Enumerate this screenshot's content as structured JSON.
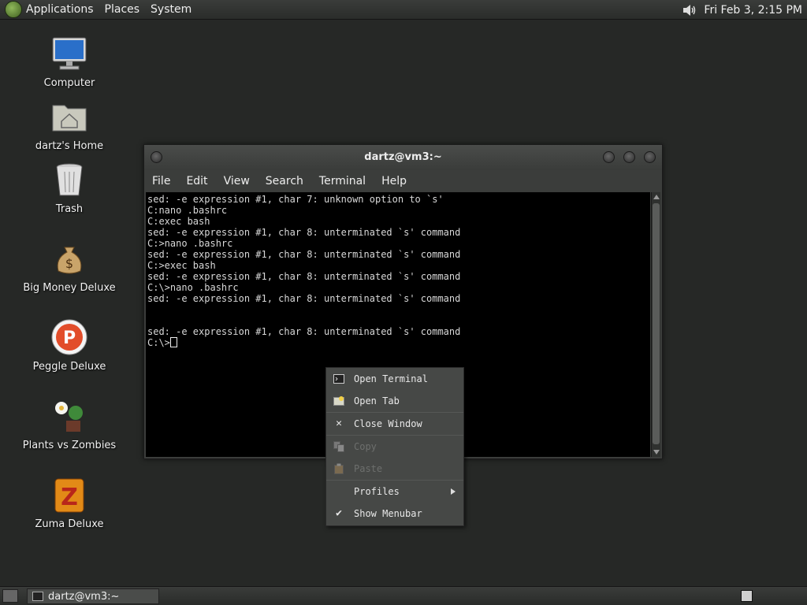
{
  "top_panel": {
    "menus": [
      "Applications",
      "Places",
      "System"
    ],
    "clock": "Fri Feb  3,  2:15 PM",
    "icons": {
      "logo": "gnome-foot-icon",
      "volume": "volume-icon"
    }
  },
  "desktop_icons": [
    {
      "label": "Computer",
      "icon": "computer-icon"
    },
    {
      "label": "dartz's Home",
      "icon": "home-folder-icon"
    },
    {
      "label": "Trash",
      "icon": "trash-icon"
    },
    {
      "label": "Big Money Deluxe",
      "icon": "money-bag-icon"
    },
    {
      "label": "Peggle Deluxe",
      "icon": "peggle-icon"
    },
    {
      "label": "Plants vs Zombies",
      "icon": "plants-icon"
    },
    {
      "label": "Zuma Deluxe",
      "icon": "zuma-icon"
    }
  ],
  "terminal": {
    "title": "dartz@vm3:~",
    "menubar": [
      "File",
      "Edit",
      "View",
      "Search",
      "Terminal",
      "Help"
    ],
    "lines": [
      "sed: -e expression #1, char 7: unknown option to `s'",
      "C:nano .bashrc",
      "C:exec bash",
      "sed: -e expression #1, char 8: unterminated `s' command",
      "C:>nano .bashrc",
      "sed: -e expression #1, char 8: unterminated `s' command",
      "C:>exec bash",
      "sed: -e expression #1, char 8: unterminated `s' command",
      "C:\\>nano .bashrc",
      "sed: -e expression #1, char 8: unterminated `s' command",
      "",
      "",
      "sed: -e expression #1, char 8: unterminated `s' command"
    ],
    "prompt": "C:\\>"
  },
  "context_menu": {
    "items": [
      {
        "label": "Open Terminal",
        "icon": "terminal-icon",
        "disabled": false
      },
      {
        "label": "Open Tab",
        "icon": "new-tab-icon",
        "disabled": false
      },
      {
        "label": "Close Window",
        "icon": "close-icon",
        "disabled": false
      },
      {
        "label": "Copy",
        "icon": "copy-icon",
        "disabled": true
      },
      {
        "label": "Paste",
        "icon": "paste-icon",
        "disabled": true
      },
      {
        "label": "Profiles",
        "icon": "",
        "disabled": false
      },
      {
        "label": "Show Menubar",
        "icon": "checkmark-icon",
        "disabled": false
      }
    ]
  },
  "bottom_panel": {
    "task_label": "dartz@vm3:~"
  }
}
